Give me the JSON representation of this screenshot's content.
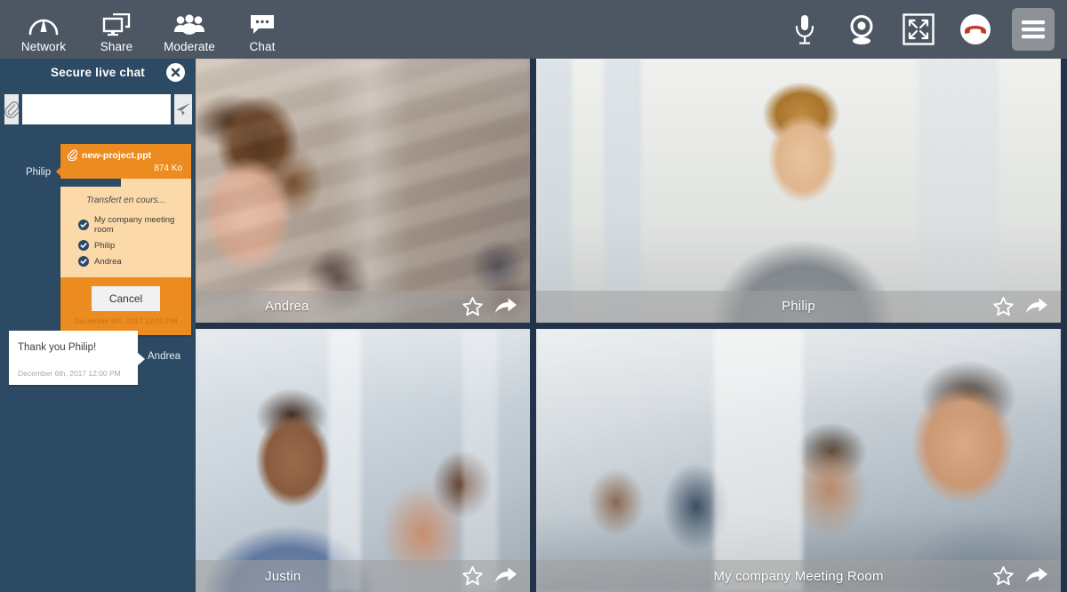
{
  "toolbar": {
    "left_items": [
      {
        "label": "Network",
        "icon": "network-signal-icon"
      },
      {
        "label": "Share",
        "icon": "screen-share-icon"
      },
      {
        "label": "Moderate",
        "icon": "people-group-icon"
      },
      {
        "label": "Chat",
        "icon": "chat-bubble-icon"
      }
    ],
    "right_items": [
      {
        "name": "microphone-icon",
        "label": "Microphone"
      },
      {
        "name": "webcam-icon",
        "label": "Webcam"
      },
      {
        "name": "fullscreen-icon",
        "label": "Fullscreen"
      },
      {
        "name": "hang-up-icon",
        "label": "Hang up"
      },
      {
        "name": "hamburger-menu-icon",
        "label": "Menu"
      }
    ],
    "background": "#4d5764",
    "menu_button_background": "#8d9299",
    "hangup_color": "#c0392b"
  },
  "sidebar": {
    "title": "Secure live chat",
    "close_label": "Close chat",
    "background": "#2c4a63",
    "composer": {
      "attach_label": "Attach file",
      "input_value": "",
      "input_placeholder": "",
      "send_label": "Send"
    },
    "file_transfer": {
      "sender": "Philip",
      "filename": "new-project.ppt",
      "filesize": "874 Ko",
      "status": "Transfert en cours...",
      "progress_percent": 46,
      "recipients": [
        "My company meeting room",
        "Philip",
        "Andrea"
      ],
      "cancel_label": "Cancel",
      "timestamp": "December 6th, 2017 12:00 PM",
      "accent_color": "#ec8b1f",
      "body_color": "#fbd9a8"
    },
    "messages": [
      {
        "text": "Thank you Philip!",
        "timestamp": "December 6th, 2017 12:00 PM",
        "sender": "Andrea"
      }
    ]
  },
  "grid": {
    "background": "#23344a",
    "tiles": [
      {
        "name": "Andrea",
        "align": "left",
        "favorite_label": "Add to favorites",
        "share_label": "Share"
      },
      {
        "name": "Philip",
        "align": "center",
        "favorite_label": "Add to favorites",
        "share_label": "Share"
      },
      {
        "name": "Justin",
        "align": "left",
        "favorite_label": "Add to favorites",
        "share_label": "Share"
      },
      {
        "name": "My company Meeting Room",
        "align": "center",
        "favorite_label": "Add to favorites",
        "share_label": "Share"
      }
    ]
  }
}
